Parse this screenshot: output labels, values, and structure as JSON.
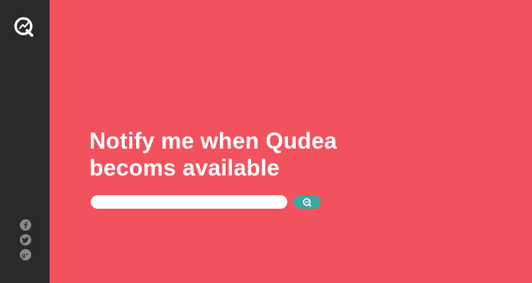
{
  "brand": {
    "logo_icon": "qudea-q-logo-icon",
    "colors": {
      "background": "#f2525e",
      "sidebar": "#2a2a2a",
      "accent": "#3fa6a3",
      "social_icon": "#8a8a8a"
    }
  },
  "main": {
    "headline_line1": "Notify me when Qudea",
    "headline_line2": "becoms available",
    "email_input": {
      "value": "",
      "placeholder": ""
    },
    "submit_icon": "qudea-q-icon"
  },
  "sidebar": {
    "social_links": [
      {
        "icon": "facebook-icon"
      },
      {
        "icon": "twitter-icon"
      },
      {
        "icon": "google-plus-icon"
      }
    ]
  }
}
